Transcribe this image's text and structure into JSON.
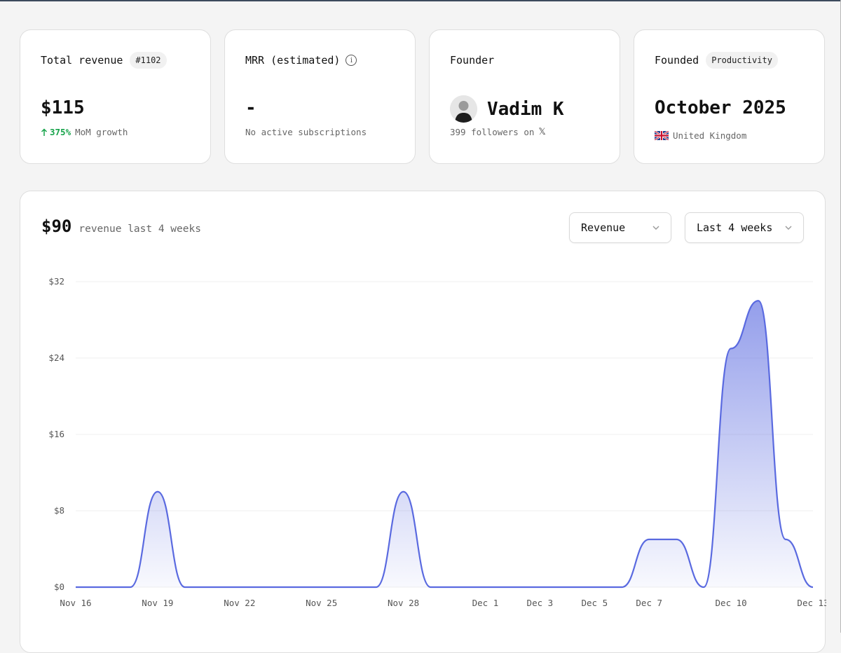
{
  "cards": {
    "revenue": {
      "title": "Total revenue",
      "rank": "#1102",
      "value": "$115",
      "growth": "375%",
      "growth_caption": "MoM growth"
    },
    "mrr": {
      "title": "MRR (estimated)",
      "value": "-",
      "caption": "No active subscriptions"
    },
    "founder": {
      "title": "Founder",
      "name": "Vadim K",
      "followers": "399 followers on",
      "platform_icon": "x-icon"
    },
    "founded": {
      "title": "Founded",
      "category": "Productivity",
      "date": "October 2025",
      "country": "United Kingdom"
    }
  },
  "panel": {
    "amount": "$90",
    "caption": "revenue last 4 weeks",
    "metric_select": "Revenue",
    "range_select": "Last 4 weeks"
  },
  "colors": {
    "accent": "#5a6ae0",
    "growth": "#16a34a"
  },
  "chart_data": {
    "type": "area",
    "ylim": [
      0,
      32
    ],
    "yticks": [
      "$0",
      "$8",
      "$16",
      "$24",
      "$32"
    ],
    "ytick_values": [
      0,
      8,
      16,
      24,
      32
    ],
    "xtick_labels": [
      "Nov 16",
      "Nov 19",
      "Nov 22",
      "Nov 25",
      "Nov 28",
      "Dec 1",
      "Dec 3",
      "Dec 5",
      "Dec 7",
      "Dec 10",
      "Dec 13"
    ],
    "series": [
      {
        "x": [
          "Nov 16",
          "Nov 17",
          "Nov 18",
          "Nov 19",
          "Nov 20",
          "Nov 21",
          "Nov 22",
          "Nov 23",
          "Nov 24",
          "Nov 25",
          "Nov 26",
          "Nov 27",
          "Nov 28",
          "Nov 29",
          "Nov 30",
          "Dec 1",
          "Dec 2",
          "Dec 3",
          "Dec 4",
          "Dec 5",
          "Dec 6",
          "Dec 7",
          "Dec 8",
          "Dec 9",
          "Dec 10",
          "Dec 11",
          "Dec 12",
          "Dec 13"
        ],
        "values": [
          0,
          0,
          0,
          10,
          0,
          0,
          0,
          0,
          0,
          0,
          0,
          0,
          10,
          0,
          0,
          0,
          0,
          0,
          0,
          0,
          0,
          5,
          5,
          0,
          25,
          30,
          5,
          0
        ]
      }
    ],
    "grid": true
  }
}
